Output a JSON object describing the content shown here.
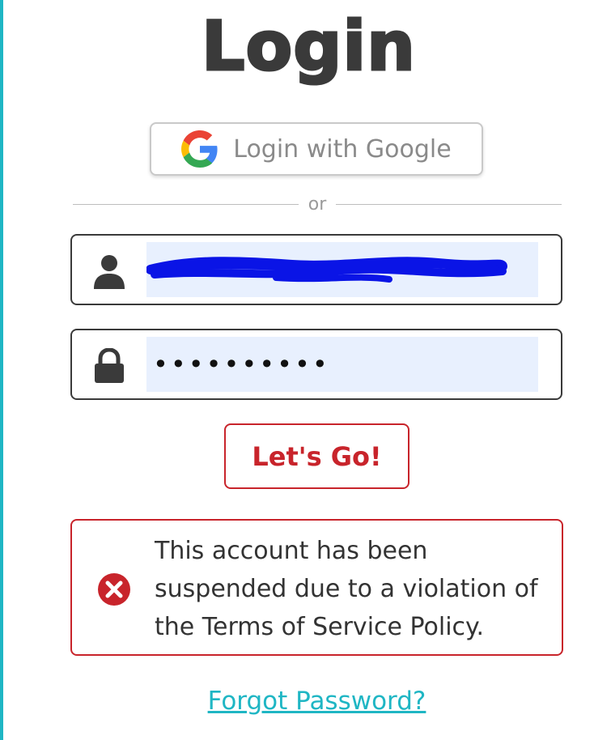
{
  "login": {
    "title": "Login",
    "google_label": "Login with Google",
    "divider_text": "or",
    "username_value": "",
    "password_value": "••••••••••",
    "submit_label": "Let's Go!",
    "error_message": "This account has been suspended due to a violation of the Terms of Service Policy.",
    "forgot_label": "Forgot Password?"
  },
  "icons": {
    "google": "google-g-icon",
    "user": "user-icon",
    "lock": "lock-icon",
    "error": "error-circle-x-icon"
  },
  "colors": {
    "accent": "#1fb6c4",
    "error": "#c8242b",
    "text": "#3a3a3a",
    "input_bg": "#e8f0fe"
  }
}
